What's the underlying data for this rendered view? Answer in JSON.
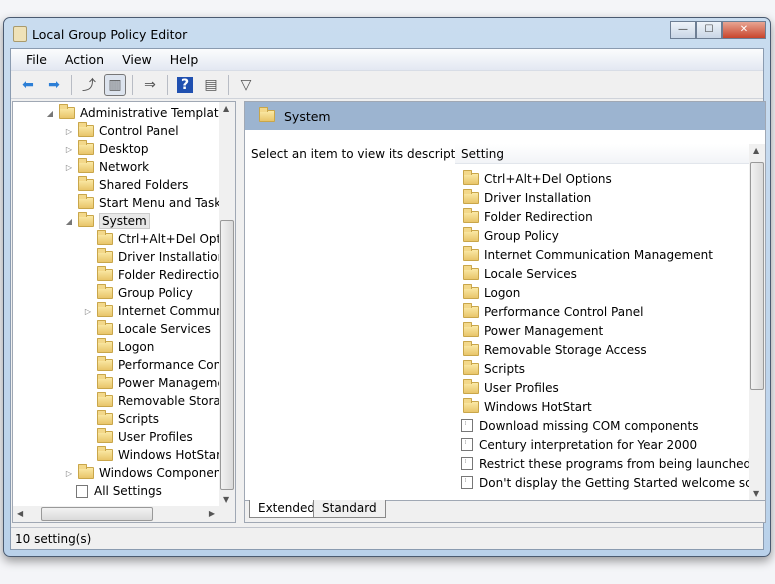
{
  "window": {
    "title": "Local Group Policy Editor",
    "minimize": "—",
    "maximize": "☐",
    "close": "✕"
  },
  "menu": [
    "File",
    "Action",
    "View",
    "Help"
  ],
  "toolbar": [
    {
      "icon": "back-icon",
      "glyph": "⬅"
    },
    {
      "icon": "forward-icon",
      "glyph": "➡"
    },
    {
      "icon": "up-folder-icon",
      "glyph": "⤴"
    },
    {
      "icon": "show-hide-tree-icon",
      "glyph": "▥"
    },
    {
      "icon": "export-list-icon",
      "glyph": "⇒"
    },
    {
      "icon": "help-icon",
      "glyph": "?"
    },
    {
      "icon": "show-action-pane-icon",
      "glyph": "▤"
    },
    {
      "icon": "filter-icon",
      "glyph": "▽"
    }
  ],
  "tree": [
    {
      "label": "Administrative Templates",
      "level": 0,
      "arrow": "◢"
    },
    {
      "label": "Control Panel",
      "level": 1,
      "arrow": "▷"
    },
    {
      "label": "Desktop",
      "level": 1,
      "arrow": "▷"
    },
    {
      "label": "Network",
      "level": 1,
      "arrow": "▷"
    },
    {
      "label": "Shared Folders",
      "level": 1,
      "arrow": ""
    },
    {
      "label": "Start Menu and Taskbar",
      "level": 1,
      "arrow": ""
    },
    {
      "label": "System",
      "level": 1,
      "arrow": "◢",
      "selected": true
    },
    {
      "label": "Ctrl+Alt+Del Options",
      "level": 2,
      "arrow": ""
    },
    {
      "label": "Driver Installation",
      "level": 2,
      "arrow": ""
    },
    {
      "label": "Folder Redirection",
      "level": 2,
      "arrow": ""
    },
    {
      "label": "Group Policy",
      "level": 2,
      "arrow": ""
    },
    {
      "label": "Internet Communication Management",
      "level": 2,
      "arrow": "▷"
    },
    {
      "label": "Locale Services",
      "level": 2,
      "arrow": ""
    },
    {
      "label": "Logon",
      "level": 2,
      "arrow": ""
    },
    {
      "label": "Performance Control Panel",
      "level": 2,
      "arrow": ""
    },
    {
      "label": "Power Management",
      "level": 2,
      "arrow": ""
    },
    {
      "label": "Removable Storage Access",
      "level": 2,
      "arrow": ""
    },
    {
      "label": "Scripts",
      "level": 2,
      "arrow": ""
    },
    {
      "label": "User Profiles",
      "level": 2,
      "arrow": ""
    },
    {
      "label": "Windows HotStart",
      "level": 2,
      "arrow": ""
    },
    {
      "label": "Windows Components",
      "level": 1,
      "arrow": "▷"
    },
    {
      "label": "All Settings",
      "level": 1,
      "arrow": "",
      "type": "settings"
    }
  ],
  "right": {
    "header": "System",
    "description": "Select an item to view its description.",
    "column": "Setting",
    "items": [
      {
        "label": "Ctrl+Alt+Del Options",
        "type": "folder"
      },
      {
        "label": "Driver Installation",
        "type": "folder"
      },
      {
        "label": "Folder Redirection",
        "type": "folder"
      },
      {
        "label": "Group Policy",
        "type": "folder"
      },
      {
        "label": "Internet Communication Management",
        "type": "folder"
      },
      {
        "label": "Locale Services",
        "type": "folder"
      },
      {
        "label": "Logon",
        "type": "folder"
      },
      {
        "label": "Performance Control Panel",
        "type": "folder"
      },
      {
        "label": "Power Management",
        "type": "folder"
      },
      {
        "label": "Removable Storage Access",
        "type": "folder"
      },
      {
        "label": "Scripts",
        "type": "folder"
      },
      {
        "label": "User Profiles",
        "type": "folder"
      },
      {
        "label": "Windows HotStart",
        "type": "folder"
      },
      {
        "label": "Download missing COM components",
        "type": "setting"
      },
      {
        "label": "Century interpretation for Year 2000",
        "type": "setting"
      },
      {
        "label": "Restrict these programs from being launched from Help",
        "type": "setting"
      },
      {
        "label": "Don't display the Getting Started welcome screen at logon",
        "type": "setting"
      }
    ]
  },
  "tabs": [
    "Extended",
    "Standard"
  ],
  "status": "10 setting(s)"
}
